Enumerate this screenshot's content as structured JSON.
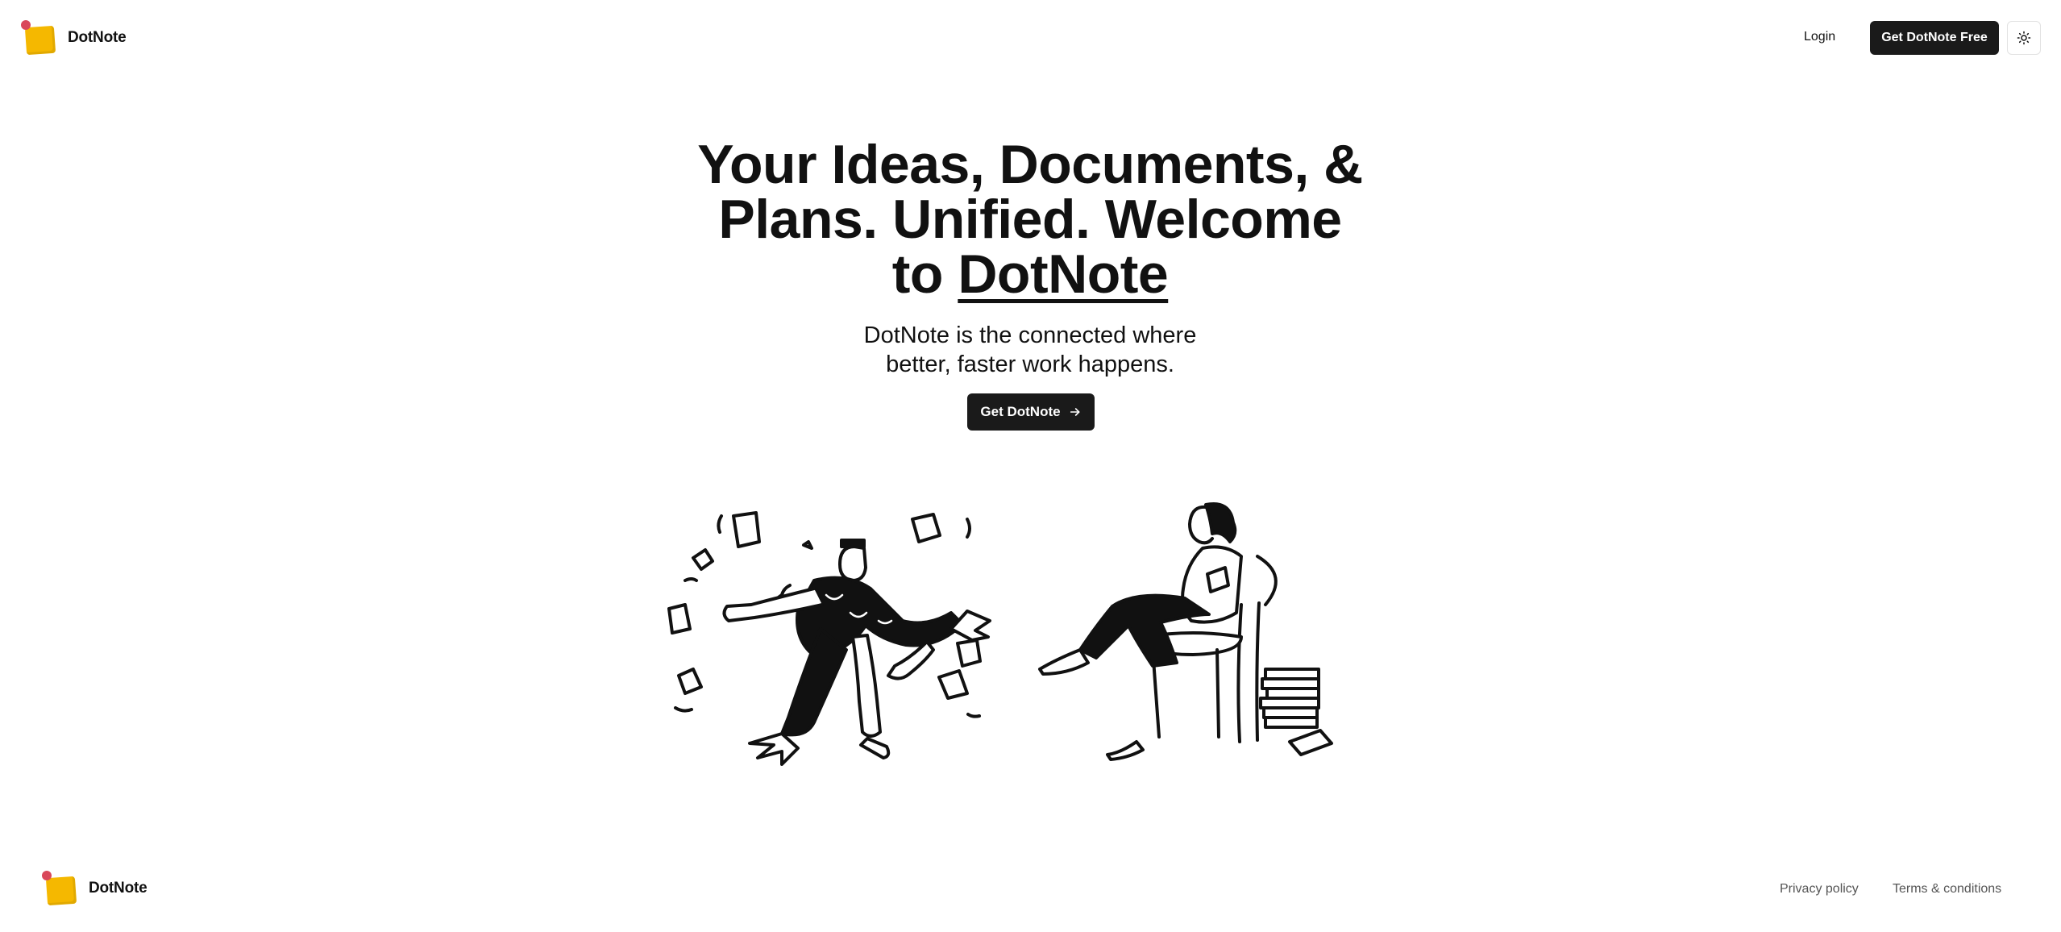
{
  "brand": {
    "name": "DotNote",
    "note_color": "#f5b800",
    "pin_color": "#d9475a"
  },
  "header": {
    "login_label": "Login",
    "cta_label": "Get DotNote Free",
    "theme_icon": "sun-icon"
  },
  "hero": {
    "title_line1": "Your Ideas, Documents, &",
    "title_line2": "Plans. Unified. Welcome",
    "title_line3_prefix": "to ",
    "title_brand": "DotNote",
    "subtitle_line1": "DotNote is the connected where",
    "subtitle_line2": "better, faster work happens.",
    "button_label": "Get DotNote",
    "button_icon": "arrow-right-icon"
  },
  "illustrations": {
    "left": "running-man-with-papers-illustration",
    "right": "woman-reading-in-chair-illustration"
  },
  "footer": {
    "brand_name": "DotNote",
    "privacy_label": "Privacy policy",
    "terms_label": "Terms & conditions"
  }
}
